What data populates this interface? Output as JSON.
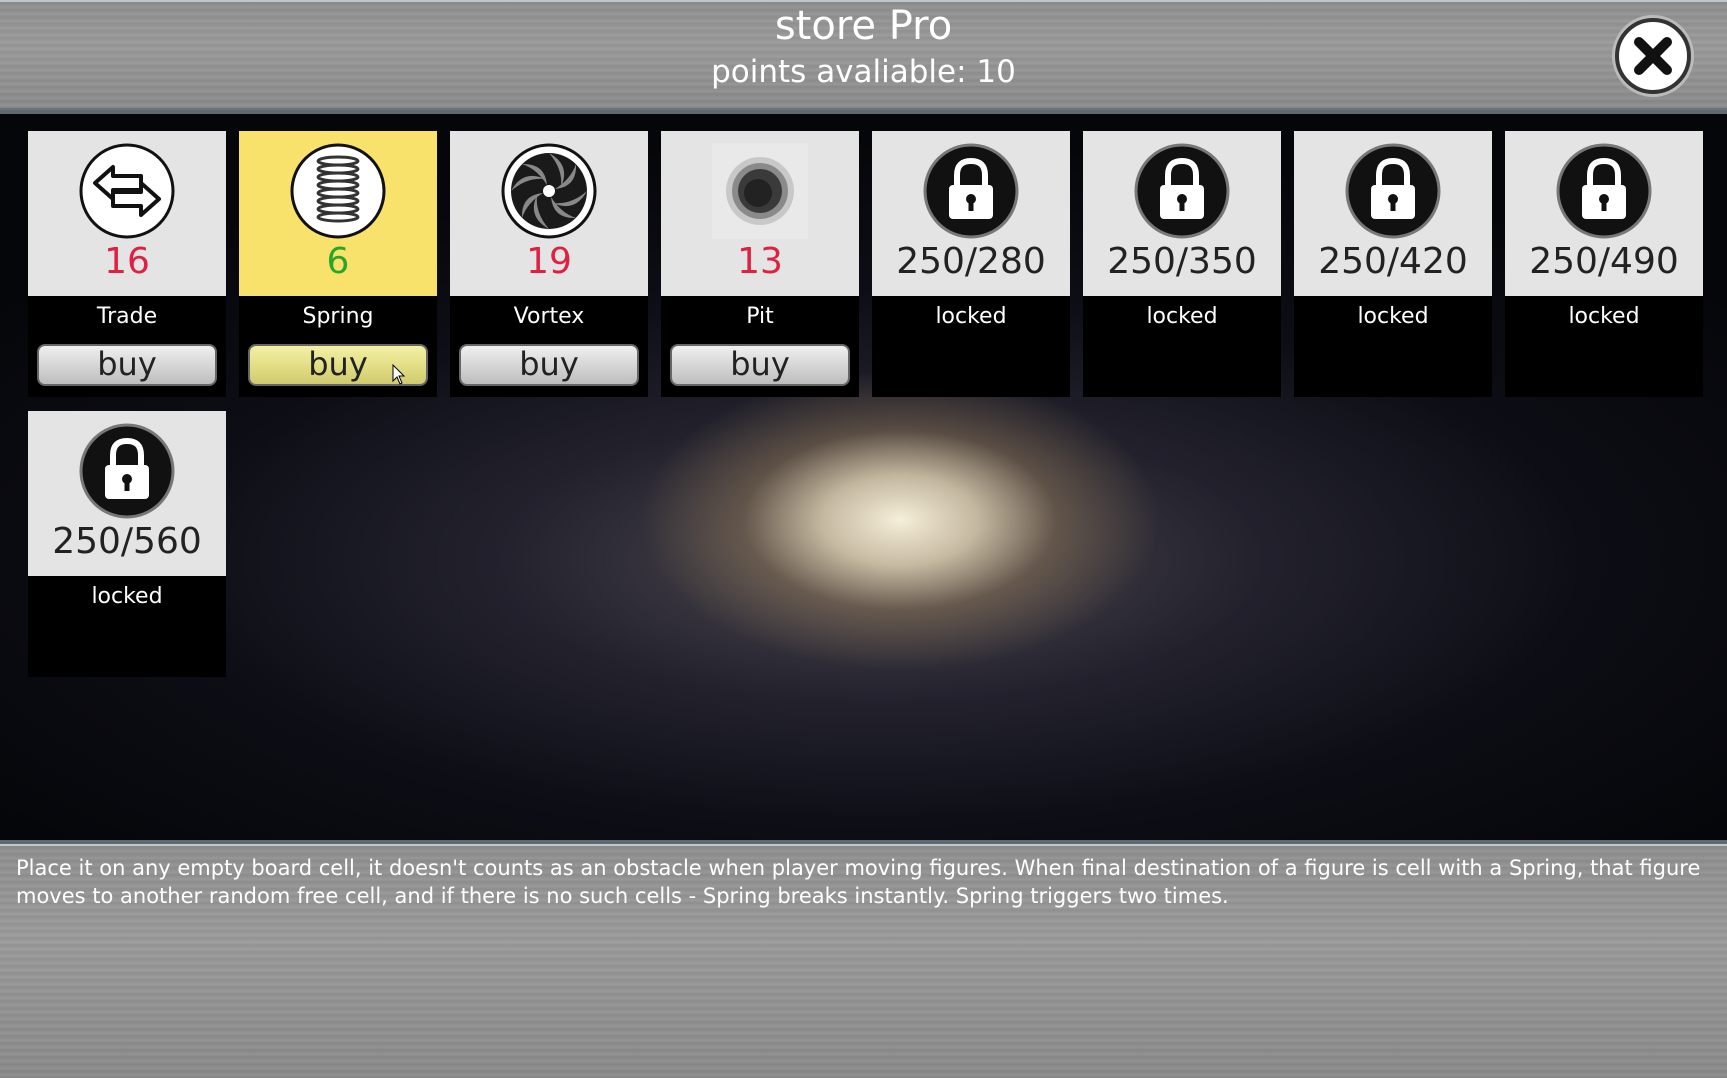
{
  "header": {
    "title": "store Pro",
    "points": "points avaliable: 10",
    "close_icon": "close-x-icon"
  },
  "items": [
    {
      "name": "Trade",
      "price": "16",
      "icon": "arrows-swap-icon",
      "state": "unaffordable",
      "buy_label": "buy"
    },
    {
      "name": "Spring",
      "price": "6",
      "icon": "spring-coil-icon",
      "state": "affordable-selected",
      "buy_label": "buy"
    },
    {
      "name": "Vortex",
      "price": "19",
      "icon": "vortex-icon",
      "state": "unaffordable",
      "buy_label": "buy"
    },
    {
      "name": "Pit",
      "price": "13",
      "icon": "pit-hole-icon",
      "state": "unaffordable",
      "buy_label": "buy"
    },
    {
      "name": "locked",
      "price": "250/280",
      "icon": "padlock-icon",
      "state": "locked"
    },
    {
      "name": "locked",
      "price": "250/350",
      "icon": "padlock-icon",
      "state": "locked"
    },
    {
      "name": "locked",
      "price": "250/420",
      "icon": "padlock-icon",
      "state": "locked"
    },
    {
      "name": "locked",
      "price": "250/490",
      "icon": "padlock-icon",
      "state": "locked"
    },
    {
      "name": "locked",
      "price": "250/560",
      "icon": "padlock-icon",
      "state": "locked"
    }
  ],
  "description": "Place it on any empty board cell, it doesn't counts as an obstacle when player moving figures. When final destination of a figure is cell with a Spring, that figure moves to another random free cell, and if there is no such cells - Spring breaks instantly. Spring triggers two times.",
  "colors": {
    "price_unaffordable": "#e02040",
    "price_affordable": "#2aa52a",
    "selected_card": "#f8e26c"
  }
}
